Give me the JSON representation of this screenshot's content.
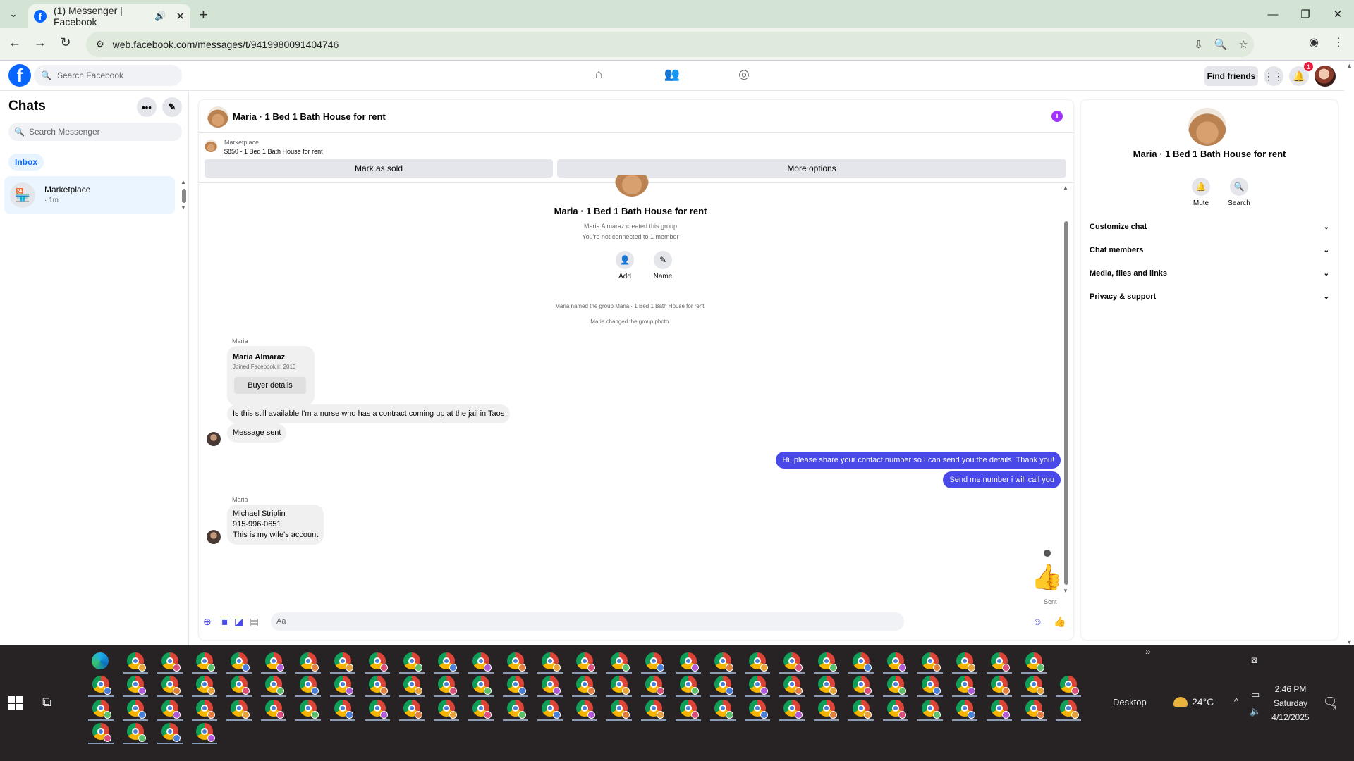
{
  "browser": {
    "tab_title": "(1) Messenger | Facebook",
    "url": "web.facebook.com/messages/t/9419980091404746"
  },
  "fb_header": {
    "search_placeholder": "Search Facebook",
    "find_friends": "Find friends",
    "notification_count": "1"
  },
  "chats": {
    "title": "Chats",
    "search_placeholder": "Search Messenger",
    "filter_inbox": "Inbox",
    "items": [
      {
        "name": "Marketplace",
        "time": "· 1m"
      }
    ]
  },
  "conversation": {
    "title": "Maria · 1 Bed 1 Bath House for rent",
    "marketplace_label": "Marketplace",
    "listing": "$850 - 1 Bed 1 Bath House for rent",
    "mark_sold": "Mark as sold",
    "more_options": "More options",
    "group_title": "Maria · 1 Bed 1 Bath House for rent",
    "group_created": "Maria Almaraz created this group",
    "not_connected": "You're not connected to 1 member",
    "add_label": "Add",
    "name_label": "Name",
    "system_1": "Maria named the group Maria · 1 Bed 1 Bath House for rent.",
    "system_2": "Maria changed the group photo.",
    "sender_1": "Maria",
    "card_name": "Maria Almaraz",
    "card_joined": "Joined Facebook in 2010",
    "card_button": "Buyer details",
    "msg_1": "Is this still available I'm a nurse who has a contract coming up at the jail in Taos",
    "msg_2": "Message sent",
    "mine_1": "Hi, please share your contact number so I can send you the details. Thank you!",
    "mine_2": "Send me number i will call you",
    "sender_2": "Maria",
    "msg_3_line1": "Michael Striplin",
    "msg_3_line2": "915-996-0651",
    "msg_3_line3": "This is my wife's account",
    "sent_label": "Sent",
    "composer_placeholder": "Aa"
  },
  "info_panel": {
    "name": "Maria · 1 Bed 1 Bath House for rent",
    "mute": "Mute",
    "search": "Search",
    "sections": [
      "Customize chat",
      "Chat members",
      "Media, files and links",
      "Privacy & support"
    ]
  },
  "taskbar": {
    "desktop": "Desktop",
    "temperature": "24°C",
    "time": "2:46 PM",
    "day": "Saturday",
    "date": "4/12/2025",
    "notif_count": "3"
  },
  "colors": {
    "fb_blue": "#0866ff",
    "my_bubble": "#4849e8",
    "info_purple": "#a033ff",
    "chrome_green": "#d3e3d4"
  }
}
